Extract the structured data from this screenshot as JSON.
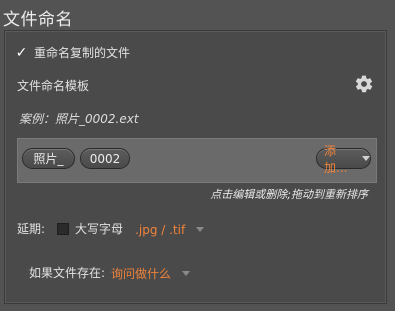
{
  "section_title": "文件命名",
  "rename_copies": {
    "label": "重命名复制的文件",
    "checked": true,
    "check_glyph": "✓"
  },
  "template": {
    "label": "文件命名模板",
    "settings_icon": "gear-icon",
    "example": "案例：照片_0002.ext",
    "tokens": [
      "照片_",
      "0002"
    ],
    "add_label": "添加..."
  },
  "hint": "点击编辑或删除;拖动到重新排序",
  "extension": {
    "label": "延期:",
    "uppercase_label": "大写字母",
    "uppercase_checked": false,
    "selected": ".jpg / .tif"
  },
  "file_exists": {
    "label": "如果文件存在:",
    "selected": "询问做什么"
  },
  "colors": {
    "accent": "#f0833a",
    "panel_bg": "#4a4a4a",
    "page_bg": "#535353"
  }
}
